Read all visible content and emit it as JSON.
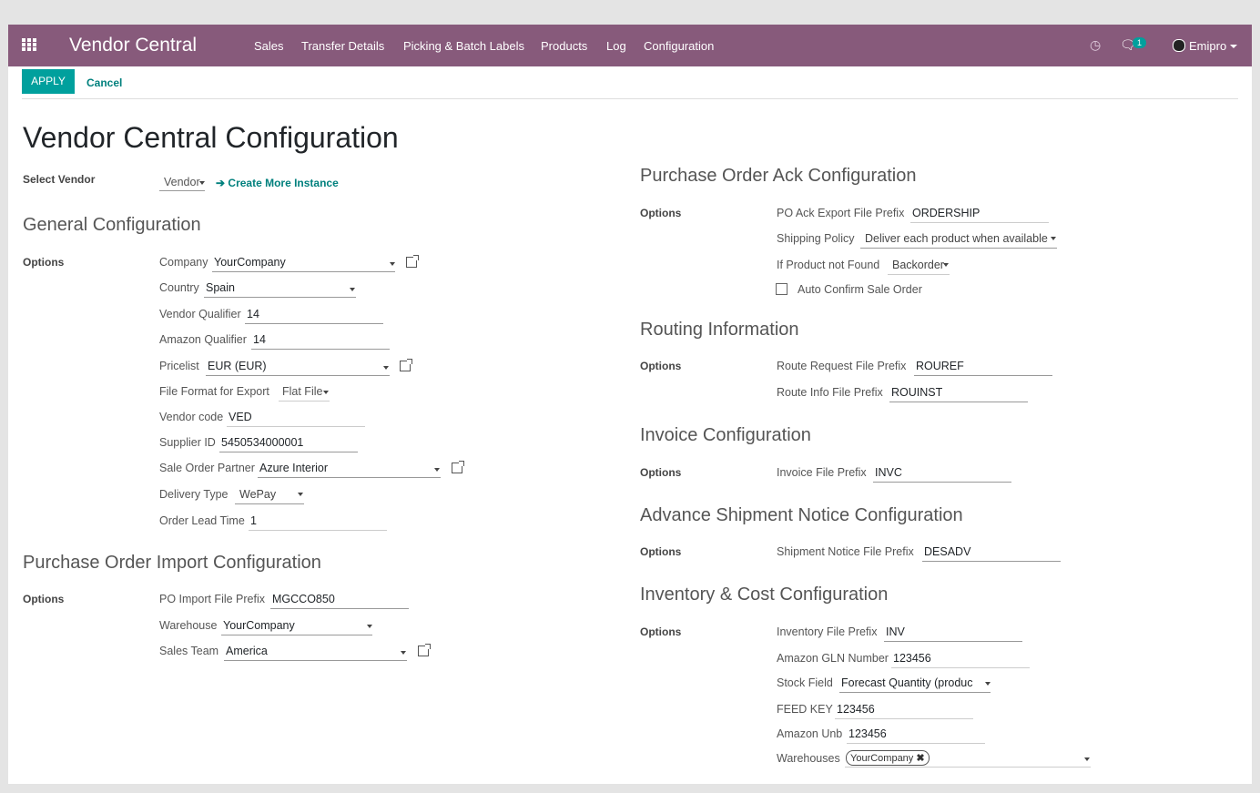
{
  "navbar": {
    "brand": "Vendor Central",
    "menus": [
      "Sales",
      "Transfer Details",
      "Picking & Batch Labels",
      "Products",
      "Log",
      "Configuration"
    ],
    "chat_count": "1",
    "user": "Emipro",
    "color": "#875a7b"
  },
  "actions": {
    "apply": "APPLY",
    "cancel": "Cancel"
  },
  "page": {
    "title": "Vendor Central Configuration",
    "select_vendor_label": "Select Vendor",
    "select_vendor_value": "Vendor",
    "create_more": "Create More Instance",
    "options_label": "Options"
  },
  "general": {
    "heading": "General Configuration",
    "company_label": "Company",
    "company": "YourCompany",
    "country_label": "Country",
    "country": "Spain",
    "vendor_qualifier_label": "Vendor Qualifier",
    "vendor_qualifier": "14",
    "amazon_qualifier_label": "Amazon Qualifier",
    "amazon_qualifier": "14",
    "pricelist_label": "Pricelist",
    "pricelist": "EUR (EUR)",
    "file_format_label": "File Format for Export",
    "file_format": "Flat File",
    "vendor_code_label": "Vendor code",
    "vendor_code": "VED",
    "supplier_id_label": "Supplier ID",
    "supplier_id": "5450534000001",
    "sale_partner_label": "Sale Order Partner",
    "sale_partner": "Azure Interior",
    "delivery_type_label": "Delivery Type",
    "delivery_type": "WePay",
    "lead_time_label": "Order Lead Time",
    "lead_time": "1"
  },
  "po_import": {
    "heading": "Purchase Order Import Configuration",
    "prefix_label": "PO Import File Prefix",
    "prefix": "MGCCO850",
    "warehouse_label": "Warehouse",
    "warehouse": "YourCompany",
    "team_label": "Sales Team",
    "team": "America"
  },
  "po_ack": {
    "heading": "Purchase Order Ack Configuration",
    "prefix_label": "PO Ack Export File Prefix",
    "prefix": "ORDERSHIP",
    "shipping_label": "Shipping Policy",
    "shipping": "Deliver each product when available",
    "notfound_label": "If Product not Found",
    "notfound": "Backorder",
    "auto_confirm_label": "Auto Confirm Sale Order"
  },
  "routing": {
    "heading": "Routing Information",
    "request_label": "Route Request File Prefix",
    "request": "ROUREF",
    "info_label": "Route Info File Prefix",
    "info": "ROUINST"
  },
  "invoice": {
    "heading": "Invoice Configuration",
    "prefix_label": "Invoice File Prefix",
    "prefix": "INVC"
  },
  "asn": {
    "heading": "Advance Shipment Notice Configuration",
    "prefix_label": "Shipment Notice File Prefix",
    "prefix": "DESADV"
  },
  "inventory": {
    "heading": "Inventory & Cost Configuration",
    "prefix_label": "Inventory File Prefix",
    "prefix": "INV",
    "gln_label": "Amazon GLN Number",
    "gln": "123456",
    "stock_label": "Stock Field",
    "stock": "Forecast Quantity (produc",
    "feed_label": "FEED KEY",
    "feed": "123456",
    "unb_label": "Amazon Unb",
    "unb": "123456",
    "warehouses_label": "Warehouses",
    "warehouse_tag": "YourCompany"
  }
}
